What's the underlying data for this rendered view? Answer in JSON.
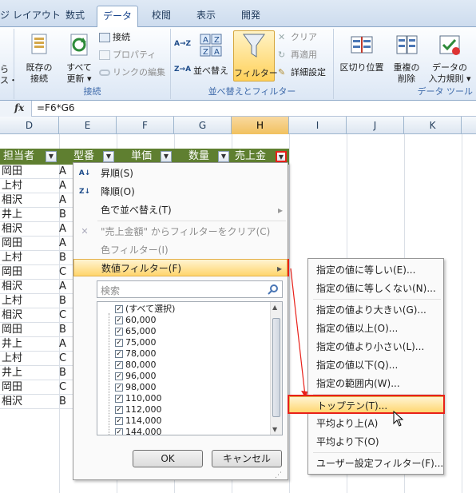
{
  "tabs": [
    "ジ レイアウト",
    "数式",
    "データ",
    "校閲",
    "表示",
    "開発"
  ],
  "ribbon": {
    "left_partial": [
      "ら",
      "ス・"
    ],
    "existing_conn": "既存の\n接続",
    "refresh_all": "すべて\n更新 ▾",
    "connections": [
      "接続",
      "プロパティ",
      "リンクの編集"
    ],
    "group_connections": "接続",
    "sort_asc": "A→Z",
    "sort_desc": "Z→A",
    "sort": "並べ替え",
    "filter": "フィルター",
    "filter_side": [
      "クリア",
      "再適用",
      "詳細設定"
    ],
    "group_sort": "並べ替えとフィルター",
    "text_to_columns": "区切り位置",
    "remove_dup": "重複の\n削除",
    "data_validation": "データの\n入力規則 ▾",
    "group_tools": "データ ツール"
  },
  "formula": {
    "fx": "fx",
    "text": "=F6*G6"
  },
  "columns": [
    "D",
    "E",
    "F",
    "G",
    "H",
    "I",
    "J",
    "K"
  ],
  "header_row": [
    "担当者",
    "型番",
    "単価",
    "数量",
    "売上金"
  ],
  "rows_d": [
    "岡田",
    "上村",
    "相沢",
    "井上",
    "相沢",
    "岡田",
    "上村",
    "岡田",
    "相沢",
    "上村",
    "相沢",
    "岡田",
    "井上",
    "上村",
    "井上",
    "岡田",
    "相沢"
  ],
  "rows_e": [
    "A",
    "A",
    "A",
    "B",
    "A",
    "A",
    "B",
    "C",
    "A",
    "B",
    "C",
    "B",
    "A",
    "C",
    "B",
    "C",
    "B"
  ],
  "menu": {
    "sort_asc": "昇順(S)",
    "sort_desc": "降順(O)",
    "sort_color": "色で並べ替え(T)",
    "clear_filter": "\"売上金額\" からフィルターをクリア(C)",
    "color_filter": "色フィルター(I)",
    "number_filter": "数値フィルター(F)",
    "search_placeholder": "検索",
    "checklist": [
      "(すべて選択)",
      "60,000",
      "65,000",
      "75,000",
      "78,000",
      "80,000",
      "96,000",
      "98,000",
      "110,000",
      "112,000",
      "114,000",
      "144,000"
    ],
    "ok": "OK",
    "cancel": "キャンセル"
  },
  "submenu": [
    "指定の値に等しい(E)...",
    "指定の値に等しくない(N)...",
    "指定の値より大きい(G)...",
    "指定の値以上(O)...",
    "指定の値より小さい(L)...",
    "指定の値以下(Q)...",
    "指定の範囲内(W)...",
    "トップテン(T)...",
    "平均より上(A)",
    "平均より下(O)",
    "ユーザー設定フィルター(F)..."
  ],
  "colors": {
    "header_fill": "#5f7f30",
    "highlight": "#ffd56c",
    "annotation": "#e8211a",
    "selected_col": "#f1c15f"
  }
}
